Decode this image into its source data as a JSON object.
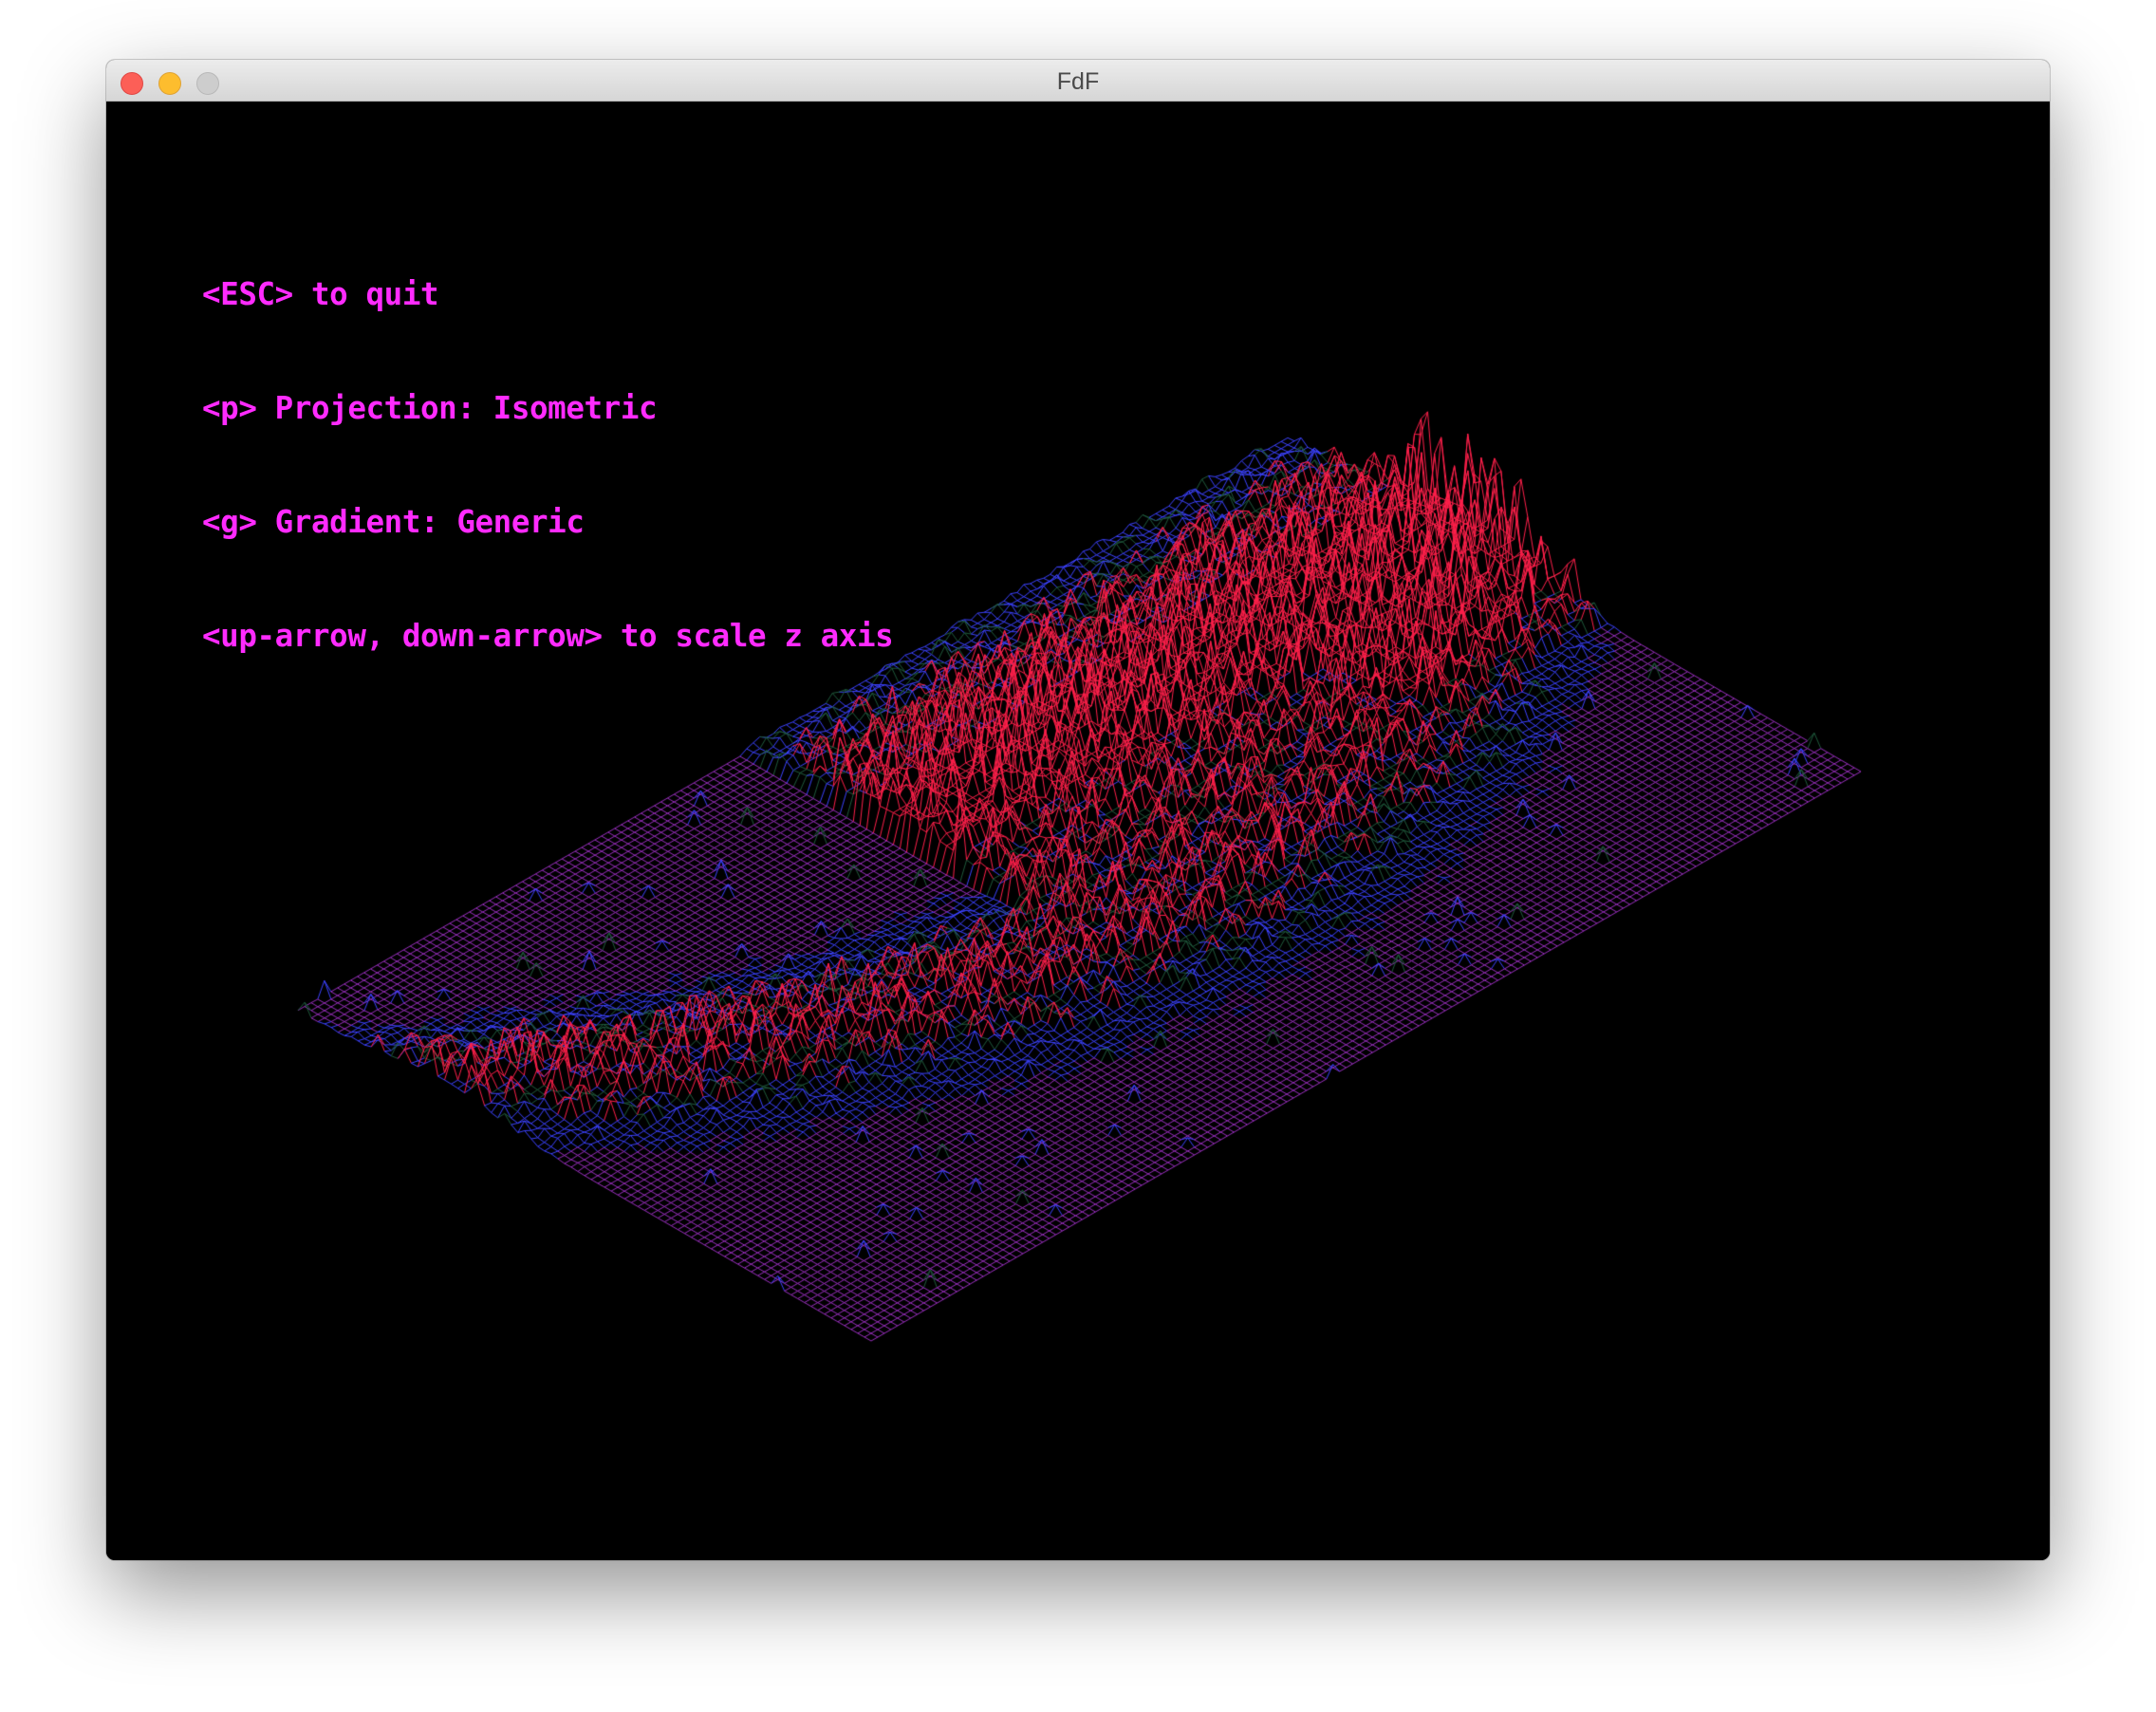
{
  "window": {
    "title": "FdF"
  },
  "help": {
    "lines": [
      "<ESC> to quit",
      "<p> Projection: Isometric",
      "<g> Gradient: Generic",
      "<up-arrow, down-arrow> to scale z axis"
    ]
  },
  "render": {
    "projection": "Isometric",
    "gradient": "Generic",
    "background_color": "#000000",
    "text_color": "#ff2bff",
    "mesh_colors": {
      "base": "#9a2fbf",
      "low": "#3c42ff",
      "mid": "#1f5a3c",
      "high": "#ff1f4a"
    }
  }
}
